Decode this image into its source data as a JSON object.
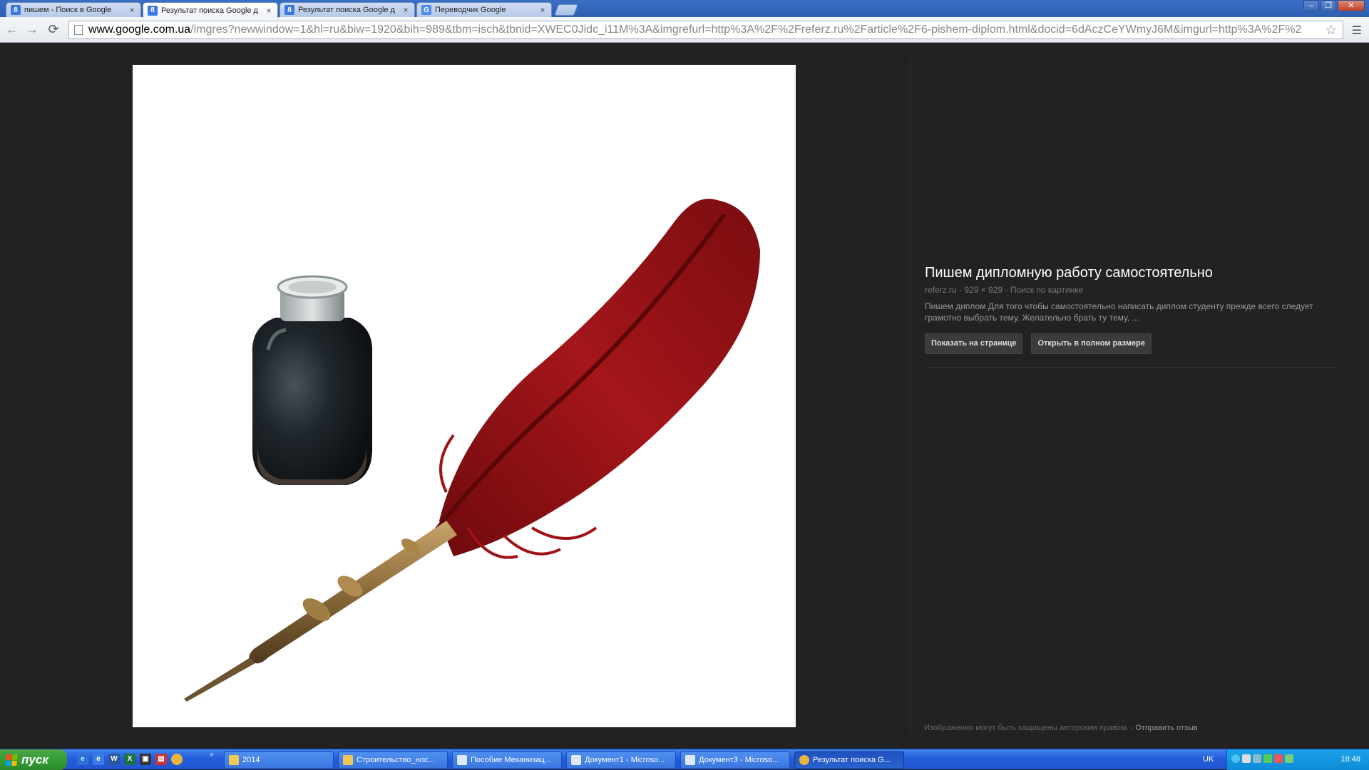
{
  "browser": {
    "tabs": [
      {
        "label": "пишем - Поиск в Google",
        "icon": "google-icon"
      },
      {
        "label": "Результат поиска Google д",
        "icon": "google-icon",
        "active": true
      },
      {
        "label": "Результат поиска Google д",
        "icon": "google-icon"
      },
      {
        "label": "Переводчик Google",
        "icon": "translate-icon"
      }
    ],
    "url_host": "www.google.com.ua",
    "url_path": "/imgres?newwindow=1&hl=ru&biw=1920&bih=989&tbm=isch&tbnid=XWEC0Jidc_i11M%3A&imgrefurl=http%3A%2F%2Freferz.ru%2Farticle%2F6-pishem-diplom.html&docid=6dAczCeYWmyJ6M&imgurl=http%3A%2F%2"
  },
  "result": {
    "title": "Пишем дипломную работу самостоятельно",
    "meta": "referz.ru - 929 × 929 - Поиск по картинке",
    "description": "Пишем диплом Для того чтобы самостоятельно написать диплом студенту прежде всего следует грамотно выбрать тему. Желательно брать ту тему, ...",
    "show_on_page": "Показать на странице",
    "open_full": "Открыть в полном размере"
  },
  "footer": {
    "note": "Изображения могут быть защищены авторским правом.  -",
    "feedback": "Отправить отзыв"
  },
  "taskbar": {
    "start_label": "пуск",
    "items": [
      {
        "label": "2014",
        "icon": "folder-icon"
      },
      {
        "label": "Строительство_нос...",
        "icon": "folder-icon"
      },
      {
        "label": "Пособие Механизац...",
        "icon": "word-icon"
      },
      {
        "label": "Документ1 - Microso...",
        "icon": "word-icon"
      },
      {
        "label": "Документ3 - Microso...",
        "icon": "word-icon"
      },
      {
        "label": "Результат поиска G...",
        "icon": "chrome-icon",
        "active": true
      }
    ],
    "lang": "UK",
    "clock": "18:48"
  },
  "colors": {
    "page_bg": "#222222",
    "feather_red": "#8e0f12",
    "ink_dark": "#1c2227",
    "brass": "#8a6a3a"
  }
}
